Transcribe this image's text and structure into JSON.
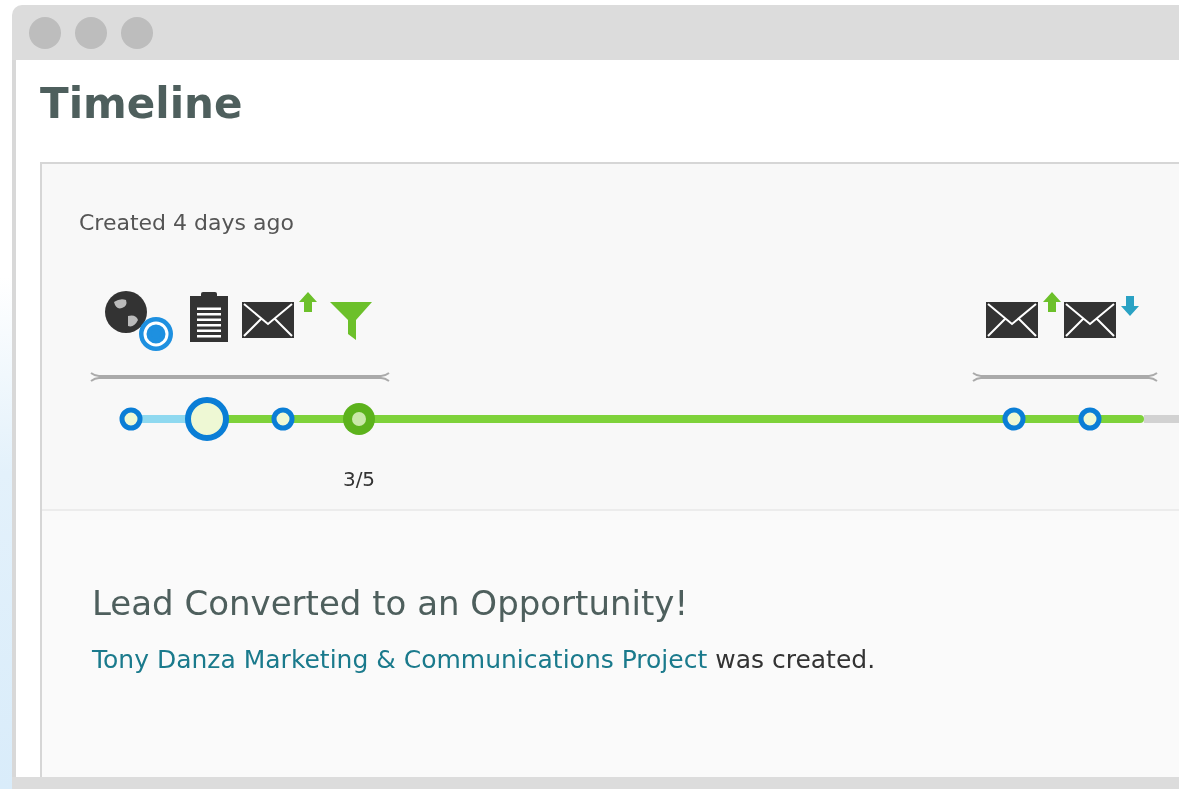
{
  "window": {
    "title": "Timeline"
  },
  "card": {
    "created": "Created 4 days ago",
    "groups": [
      {
        "icons": [
          {
            "kind": "globe-browser"
          },
          {
            "kind": "clipboard"
          },
          {
            "kind": "mail-sent"
          },
          {
            "kind": "funnel"
          }
        ],
        "nodes": [
          {
            "kind": "visit",
            "selected": false
          },
          {
            "kind": "visit",
            "selected": true
          },
          {
            "kind": "visit",
            "selected": false
          },
          {
            "kind": "stage",
            "selected": false,
            "label": "3/5"
          }
        ]
      },
      {
        "icons": [
          {
            "kind": "mail-sent"
          },
          {
            "kind": "mail-received"
          }
        ],
        "nodes": [
          {
            "kind": "visit",
            "selected": false
          },
          {
            "kind": "visit",
            "selected": false
          }
        ]
      }
    ]
  },
  "event": {
    "title": "Lead Converted to an Opportunity!",
    "link": "Tony Danza Marketing & Communications Project",
    "text": "was created."
  }
}
